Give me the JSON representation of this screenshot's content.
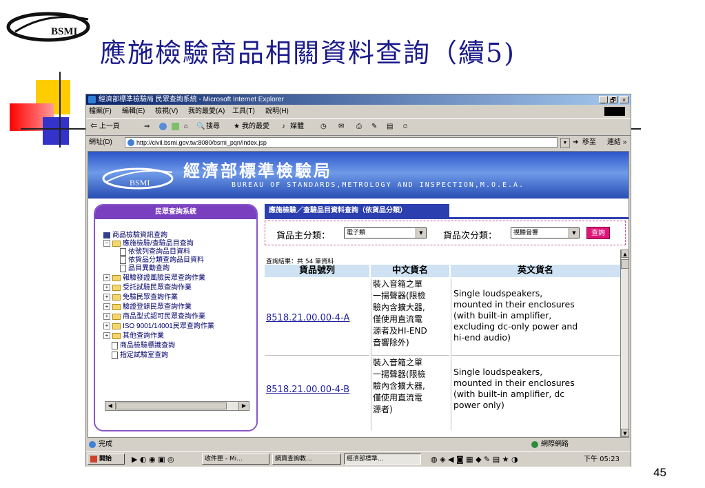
{
  "slide": {
    "logo_text": "BSMI",
    "title": "應施檢驗商品相關資料查詢（續5)",
    "page_number": "45"
  },
  "browser": {
    "window_title": "經濟部標準檢驗局 民眾查詢系統 - Microsoft Internet Explorer",
    "controls": [
      "_",
      "🗗",
      "×"
    ],
    "menu": [
      "檔案(F)",
      "編輯(E)",
      "檢視(V)",
      "我的最愛(A)",
      "工具(T)",
      "說明(H)"
    ],
    "toolbar": {
      "back": "⇐ 上一頁",
      "forward": "⇒",
      "search": "搜尋",
      "favorites": "我的最愛",
      "media": "媒體"
    },
    "address": {
      "label": "網址(D)",
      "url": "http://civil.bsmi.gov.tw:8080/bsmi_pqn/index.jsp",
      "go": "移至",
      "links": "連結 »"
    },
    "status": {
      "left": "完成",
      "zone": "網際網路"
    },
    "taskbar": {
      "start": "開始",
      "tasks": [
        "收件匣 - Mi...",
        "網頁查詢教...",
        "經濟部標準..."
      ],
      "clock": "下午 05:23"
    }
  },
  "page": {
    "banner": {
      "logo": "BSMI",
      "title_cn": "經濟部標準檢驗局",
      "title_en": "BUREAU OF STANDARDS,METROLOGY AND INSPECTION,M.O.E.A."
    },
    "left_panel": {
      "header": "民眾查詢系統",
      "tree": [
        {
          "label": "商品檢驗資訊查詢",
          "icon": "computer-icon",
          "indent": 0
        },
        {
          "label": "應施檢驗/查驗品目查詢",
          "icon": "folder-open-icon",
          "indent": 1,
          "expander": "−"
        },
        {
          "label": "依號列查詢品目資料",
          "icon": "document-icon",
          "indent": 2
        },
        {
          "label": "依貨品分類查詢品目資料",
          "icon": "document-icon",
          "indent": 2
        },
        {
          "label": "品目異動查詢",
          "icon": "document-icon",
          "indent": 2
        },
        {
          "label": "報驗發證風險民眾查詢作業",
          "icon": "folder-icon",
          "indent": 1,
          "expander": "+"
        },
        {
          "label": "受託試驗民眾查詢作業",
          "icon": "folder-icon",
          "indent": 1,
          "expander": "+"
        },
        {
          "label": "免驗民眾查詢作業",
          "icon": "folder-icon",
          "indent": 1,
          "expander": "+"
        },
        {
          "label": "驗證登錄民眾查詢作業",
          "icon": "folder-icon",
          "indent": 1,
          "expander": "+"
        },
        {
          "label": "商品型式認可民眾查詢作業",
          "icon": "folder-icon",
          "indent": 1,
          "expander": "+"
        },
        {
          "label": "ISO 9001/14001民眾查詢作業",
          "icon": "folder-icon",
          "indent": 1,
          "expander": "+"
        },
        {
          "label": "其他查詢作業",
          "icon": "folder-icon",
          "indent": 1,
          "expander": "+"
        },
        {
          "label": "商品檢驗標識查詢",
          "icon": "document-icon",
          "indent": 1
        },
        {
          "label": "指定試驗室查詢",
          "icon": "document-icon",
          "indent": 1
        }
      ]
    },
    "right_tab": "應施檢驗／查驗品目資料查詢（依貨品分類）",
    "filter": {
      "main_label": "貨品主分類：",
      "main_value": "電子類",
      "sub_label": "貨品次分類：",
      "sub_value": "視聽音響",
      "query_button": "查詢"
    },
    "result_count": "查詢結果：共 54 筆資料",
    "table": {
      "headers": [
        "貨品號列",
        "中文貨名",
        "英文貨名"
      ],
      "rows": [
        {
          "code": "8518.21.00.00-4-A",
          "cn": [
            "裝入音箱之單",
            "一揚聲器(限檢",
            "驗內含擴大器,",
            "僅使用直流電",
            "源者及HI-END",
            "音響除外)"
          ],
          "en": [
            "Single loudspeakers,",
            "mounted in their enclosures",
            "(with built-in amplifier,",
            "excluding dc-only power and",
            "hi-end audio)"
          ]
        },
        {
          "code": "8518.21.00.00-4-B",
          "cn": [
            "裝入音箱之單",
            "一揚聲器(限檢",
            "驗內含擴大器,",
            "僅使用直流電",
            "源者)"
          ],
          "en": [
            "Single loudspeakers,",
            "mounted in their enclosures",
            "(with built-in amplifier, dc",
            "power only)"
          ]
        }
      ]
    }
  }
}
